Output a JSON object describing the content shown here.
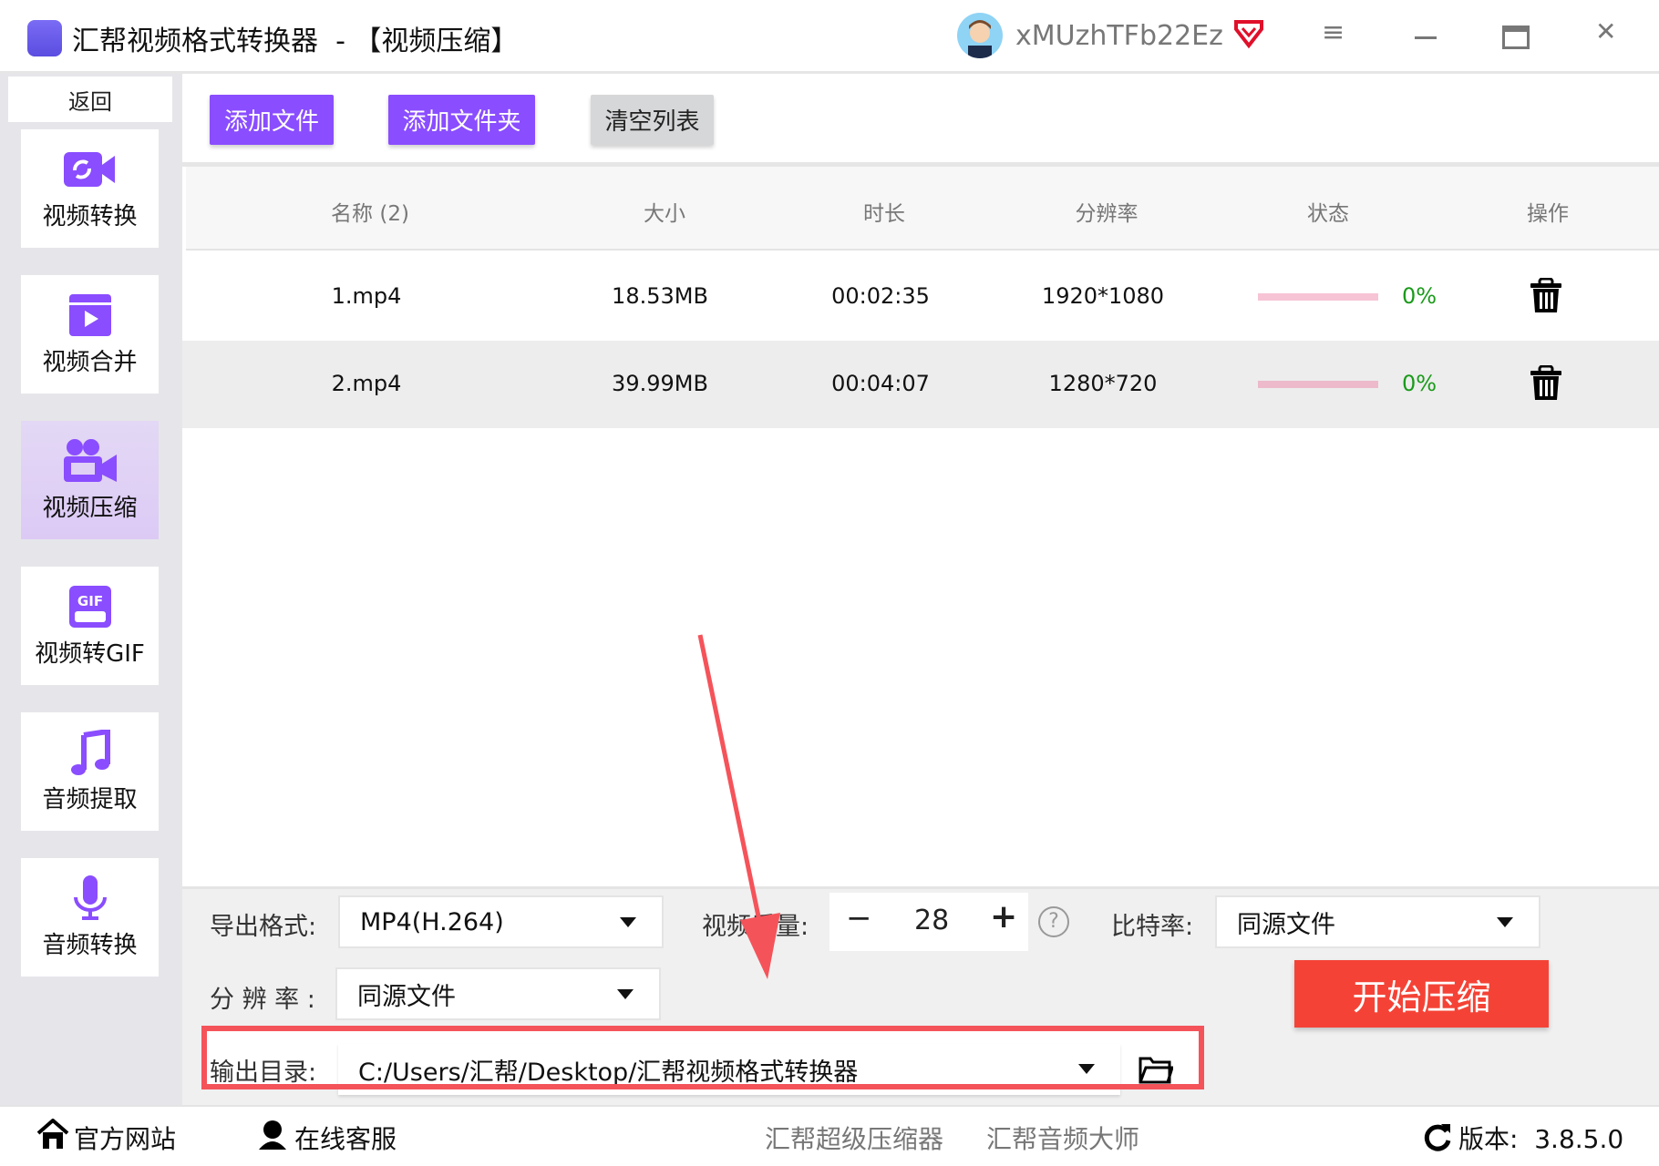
{
  "titlebar": {
    "title": "汇帮视频格式转换器  - 【视频压缩】",
    "username": "xMUzhTFb22Ez",
    "icons": [
      "app-icon",
      "avatar",
      "vip-heart-icon",
      "menu-icon",
      "minimize-icon",
      "maximize-icon",
      "close-icon"
    ]
  },
  "sidebar": {
    "back": "返回",
    "items": [
      {
        "label": "视频转换",
        "icon": "video-convert-icon"
      },
      {
        "label": "视频合并",
        "icon": "video-merge-icon"
      },
      {
        "label": "视频压缩",
        "icon": "video-compress-icon",
        "active": true
      },
      {
        "label": "视频转GIF",
        "icon": "gif-icon"
      },
      {
        "label": "音频提取",
        "icon": "music-note-icon"
      },
      {
        "label": "音频转换",
        "icon": "microphone-icon"
      }
    ]
  },
  "toolbar": {
    "add_file": "添加文件",
    "add_folder": "添加文件夹",
    "clear_list": "清空列表"
  },
  "table": {
    "headers": [
      "名称 (2)",
      "大小",
      "时长",
      "分辨率",
      "状态",
      "操作"
    ],
    "rows": [
      {
        "name": "1.mp4",
        "size": "18.53MB",
        "duration": "00:02:35",
        "resolution": "1920*1080",
        "progress": 0,
        "status": "0%"
      },
      {
        "name": "2.mp4",
        "size": "39.99MB",
        "duration": "00:04:07",
        "resolution": "1280*720",
        "progress": 0,
        "status": "0%"
      }
    ]
  },
  "settings": {
    "format_label": "导出格式:",
    "format_value": "MP4(H.264)",
    "quality_label": "视频质量:",
    "quality_minus": "−",
    "quality_value": "28",
    "quality_plus": "+",
    "help": "?",
    "bitrate_label": "比特率:",
    "bitrate_value": "同源文件",
    "resolution_label": "分 辨 率 :",
    "resolution_value": "同源文件",
    "output_label": "输出目录:",
    "output_path": "C:/Users/汇帮/Desktop/汇帮视频格式转换器",
    "start": "开始压缩"
  },
  "footer": {
    "website": "官方网站",
    "support": "在线客服",
    "link1": "汇帮超级压缩器",
    "link2": "汇帮音频大师",
    "version": "版本:  3.8.5.0"
  },
  "colors": {
    "accent": "#8a4dff",
    "start": "#f44336",
    "highlight": "#f5535a",
    "progress": "#f7c4d6",
    "status": "#1a9a1a"
  }
}
